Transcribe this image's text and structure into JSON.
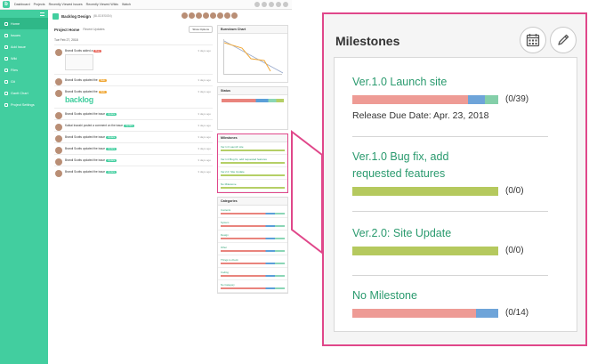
{
  "app": {
    "topnav": [
      "Dashboard",
      "Projects",
      "Recently Viewed Issues",
      "Recently Viewed Wikis",
      "Watch"
    ],
    "sidebar": [
      {
        "label": "Home",
        "active": true
      },
      {
        "label": "Issues",
        "active": false
      },
      {
        "label": "Add Issue",
        "active": false
      },
      {
        "label": "Wiki",
        "active": false
      },
      {
        "label": "Files",
        "active": false
      },
      {
        "label": "Git",
        "active": false
      },
      {
        "label": "Gantt Chart",
        "active": false
      },
      {
        "label": "Project Settings",
        "active": false
      }
    ],
    "project": {
      "name": "Backlog Design",
      "key": "(BLGDESIGN)"
    },
    "feed": {
      "title": "Project Home",
      "subtitle": "Recent Updates",
      "show_options": "Show Options",
      "date": "Tue Feb 27, 2018",
      "entries": [
        {
          "who": "Brandi Scotts",
          "action": "added a",
          "tag": "Bug",
          "ago": "3 days ago"
        },
        {
          "who": "Brandi Scotts",
          "action": "updated the",
          "tag": "Task",
          "ago": "3 days ago"
        },
        {
          "who": "Brandi Scotts",
          "action": "updated the",
          "tag": "Task",
          "ago": "3 days ago",
          "logo": "backlog"
        },
        {
          "who": "Brandi Scotts",
          "action": "updated the issue",
          "tag": "Update",
          "ago": "3 days ago"
        },
        {
          "who": "Kaikai Inaoshi",
          "action": "posted a comment on the issue",
          "tag": "Update",
          "ago": "3 days ago"
        },
        {
          "who": "Brandi Scotts",
          "action": "updated the issue",
          "tag": "Update",
          "ago": "3 days ago"
        },
        {
          "who": "Brandi Scotts",
          "action": "updated the issue",
          "tag": "Update",
          "ago": "3 days ago"
        },
        {
          "who": "Brandi Scotts",
          "action": "updated the issue",
          "tag": "Update",
          "ago": "3 days ago"
        },
        {
          "who": "Brandi Scotts",
          "action": "updated the issue",
          "tag": "Update",
          "ago": "3 days ago"
        }
      ]
    },
    "right": {
      "burndown_title": "Burndown Chart",
      "status_title": "Status",
      "milestones_title": "Milestones",
      "categories_title": "Categories",
      "mini_milestones": [
        "Ver.1.0 Launch site",
        "Ver.1.0 Bug fix, add requested features",
        "Ver.2.0: Site Update",
        "No Milestone"
      ],
      "categories": [
        "Contents",
        "System",
        "Design",
        "Other",
        "Things to check",
        "Coding",
        "No Category"
      ]
    }
  },
  "milestones_panel": {
    "title": "Milestones",
    "calendar_icon": "calendar-icon",
    "edit_icon": "pencil-icon",
    "items": [
      {
        "name_lines": [
          "Ver.1.0 Launch site"
        ],
        "count": "(0/39)",
        "due": "Release Due Date: Apr. 23, 2018",
        "segments": [
          {
            "color": "#ee9b95",
            "frac": 0.79
          },
          {
            "color": "#6ea4d9",
            "frac": 0.12
          },
          {
            "color": "#84cfa9",
            "frac": 0.09
          }
        ]
      },
      {
        "name_lines": [
          "Ver.1.0 Bug fix, add",
          "requested features"
        ],
        "count": "(0/0)",
        "due": "",
        "segments": []
      },
      {
        "name_lines": [
          "Ver.2.0: Site Update"
        ],
        "count": "(0/0)",
        "due": "",
        "segments": []
      },
      {
        "name_lines": [
          "No Milestone"
        ],
        "count": "(0/14)",
        "due": "",
        "segments": [
          {
            "color": "#ee9b95",
            "frac": 0.85
          },
          {
            "color": "#6ea4d9",
            "frac": 0.15
          }
        ]
      }
    ]
  },
  "colors": {
    "accent": "#42ce9f",
    "highlight": "#e0478a",
    "milestone_text": "#2a9a6e",
    "empty_bar": "#b5c95e"
  }
}
